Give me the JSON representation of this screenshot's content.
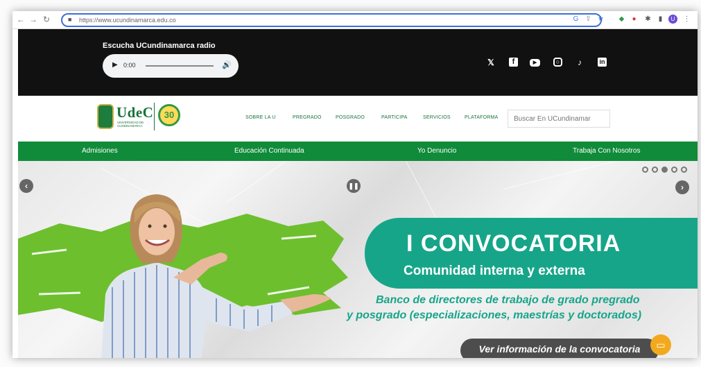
{
  "browser": {
    "url": "https://www.ucundinamarca.edu.co",
    "nav_back": "←",
    "nav_forward": "→",
    "nav_reload": "↻",
    "lock": "🔒"
  },
  "radio": {
    "label": "Escucha UCundinamarca radio",
    "time": "0:00"
  },
  "social_icons": [
    "twitter-icon",
    "facebook-icon",
    "youtube-icon",
    "instagram-icon",
    "tiktok-icon",
    "linkedin-icon"
  ],
  "logo": {
    "name": "UdeC",
    "sub": "UNIVERSIDAD DE CUNDINAMARCA",
    "anniversary": "30"
  },
  "menu": [
    "SOBRE LA U",
    "PREGRADO",
    "POSGRADO",
    "PARTICIPA",
    "SERVICIOS",
    "PLATAFORMA"
  ],
  "search": {
    "placeholder": "Buscar En UCundinamar"
  },
  "green_nav": [
    "Admisiones",
    "Educación Continuada",
    "Yo Denuncio",
    "Trabaja Con Nosotros"
  ],
  "hero": {
    "title": "I CONVOCATORIA",
    "subtitle": "Comunidad interna y externa",
    "desc_line1": "Banco de directores de trabajo de grado pregrado",
    "desc_line2": "y posgrado (especializaciones, maestrías  y doctorados)",
    "cta": "Ver información de la convocatoria",
    "dots": 5,
    "active_dot": 3
  },
  "colors": {
    "brand_green": "#108b3a",
    "teal": "#17a589",
    "splash_green": "#6dbf2e",
    "chat": "#f2a91e"
  }
}
